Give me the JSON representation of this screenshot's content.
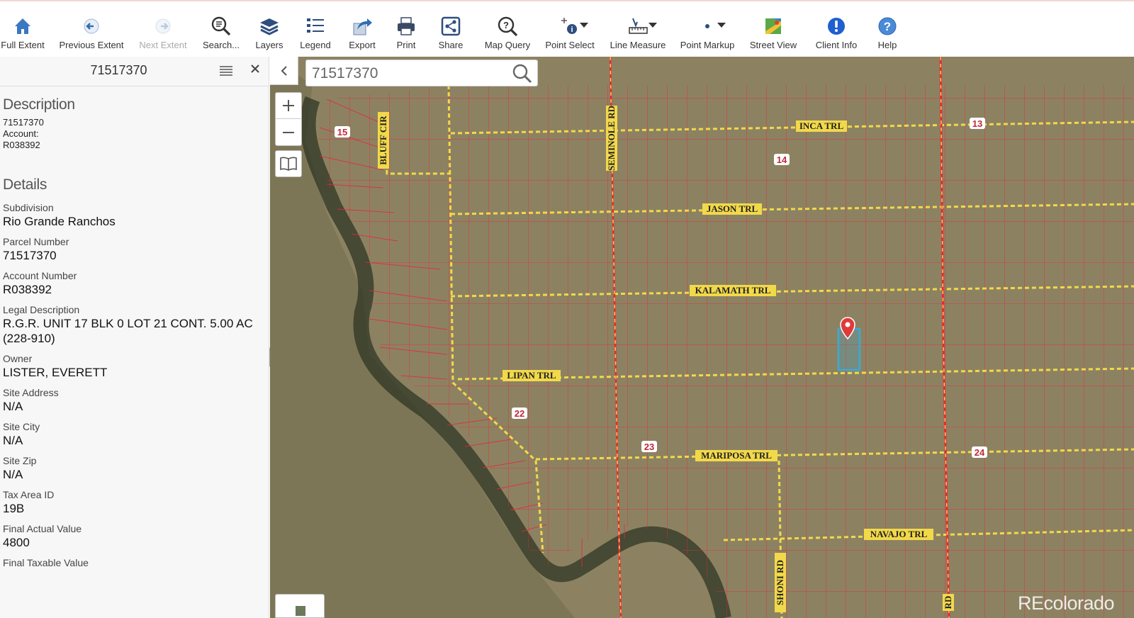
{
  "toolbar": {
    "items": [
      {
        "id": "full-extent",
        "label": "Full Extent",
        "disabled": false
      },
      {
        "id": "previous-extent",
        "label": "Previous Extent",
        "disabled": false
      },
      {
        "id": "next-extent",
        "label": "Next Extent",
        "disabled": true
      },
      {
        "id": "search",
        "label": "Search...",
        "disabled": false
      },
      {
        "id": "layers",
        "label": "Layers",
        "disabled": false
      },
      {
        "id": "legend",
        "label": "Legend",
        "disabled": false
      },
      {
        "id": "export",
        "label": "Export",
        "disabled": false
      },
      {
        "id": "print",
        "label": "Print",
        "disabled": false
      },
      {
        "id": "share",
        "label": "Share",
        "disabled": false
      },
      {
        "id": "map-query",
        "label": "Map Query",
        "disabled": false
      },
      {
        "id": "point-select",
        "label": "Point Select",
        "disabled": false
      },
      {
        "id": "line-measure",
        "label": "Line Measure",
        "disabled": false
      },
      {
        "id": "point-markup",
        "label": "Point Markup",
        "disabled": false
      },
      {
        "id": "street-view",
        "label": "Street View",
        "disabled": false
      },
      {
        "id": "client-info",
        "label": "Client Info",
        "disabled": false
      },
      {
        "id": "help",
        "label": "Help",
        "disabled": false
      }
    ]
  },
  "panel": {
    "title": "71517370",
    "description_heading": "Description",
    "description_lines": [
      "71517370",
      "Account:",
      "R038392"
    ],
    "details_heading": "Details",
    "fields": [
      {
        "label": "Subdivision",
        "value": "Rio Grande Ranchos"
      },
      {
        "label": "Parcel Number",
        "value": "71517370"
      },
      {
        "label": "Account Number",
        "value": "R038392"
      },
      {
        "label": "Legal Description",
        "value": "R.G.R. UNIT 17 BLK 0 LOT 21 CONT. 5.00 AC (228-910)"
      },
      {
        "label": "Owner",
        "value": "LISTER, EVERETT"
      },
      {
        "label": "Site Address",
        "value": "N/A"
      },
      {
        "label": "Site City",
        "value": "N/A"
      },
      {
        "label": "Site Zip",
        "value": "N/A"
      },
      {
        "label": "Tax Area ID",
        "value": "19B"
      },
      {
        "label": "Final Actual Value",
        "value": "4800"
      },
      {
        "label": "Final Taxable Value",
        "value": ""
      }
    ]
  },
  "map": {
    "search_value": "71517370",
    "watermark": "REcolorado",
    "road_labels": {
      "inca": "INCA TRL",
      "jason": "JASON TRL",
      "kalamath": "KALAMATH TRL",
      "lipan": "LIPAN TRL",
      "mariposa": "MARIPOSA TRL",
      "navajo": "NAVAJO TRL",
      "seminole": "SEMINOLE RD",
      "bluff": "BLUFF CIR",
      "shoni": "SHONI RD",
      "rd": "RD"
    },
    "section_numbers": {
      "s13": "13",
      "s14": "14",
      "s15": "15",
      "s22": "22",
      "s23": "23",
      "s24": "24"
    },
    "colors": {
      "parcel_line": "#e8283a",
      "road": "#f2d94a",
      "terrain": "#8c8262",
      "selected": "#3aa9d8"
    }
  }
}
